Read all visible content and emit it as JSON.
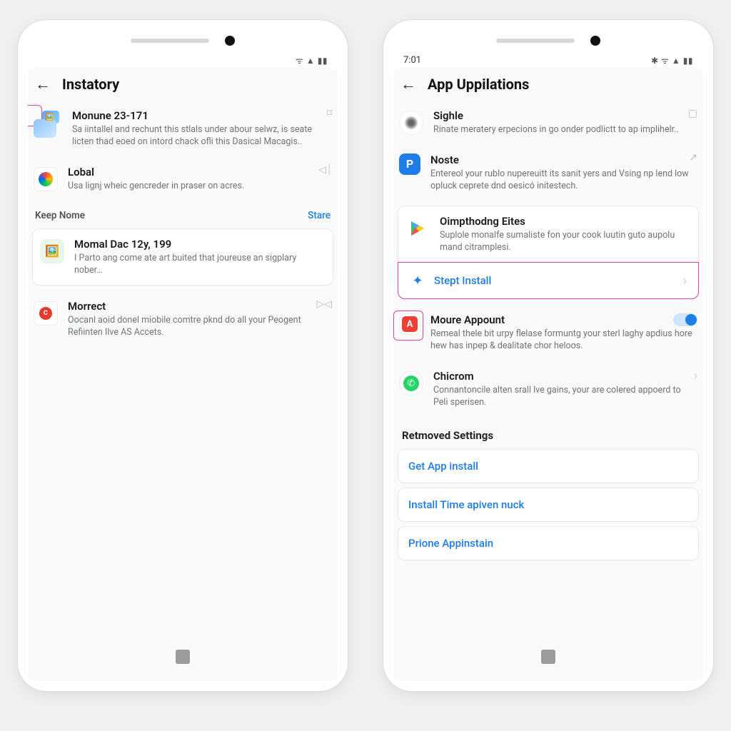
{
  "left": {
    "status": {
      "icons": "ᯤ ▲ ▮▮"
    },
    "header": {
      "title": "Instatory"
    },
    "items": [
      {
        "title": "Monune 23-171",
        "sub": "Sa iintallel and rechunt this stlals under abour selwz, is seate licten thad eoed on intord chack ofli this Dasical Macagis.."
      },
      {
        "title": "Lobal",
        "sub": "Usa lignj wheic gencreder in praser on acres."
      }
    ],
    "section": {
      "label": "Keep Nome",
      "action": "Stare"
    },
    "card_item": {
      "title": "Momal Dac 12y, 199",
      "sub": "I Parto ang come ate art buited that joureuse an sigplary nober…"
    },
    "last_item": {
      "title": "Morrect",
      "sub": "Oocanl aoid donel miobile comtre pknd do all your Peogent Refiinten Ilve AS Accets."
    }
  },
  "right": {
    "status": {
      "time": "7:01",
      "icons": "✱ ᯤ ▲ ▮▮"
    },
    "header": {
      "title": "App Uppilations"
    },
    "items": [
      {
        "title": "Sighle",
        "sub": "Rinate meratery erpecions in go onder podlictt to ap implihelr.."
      },
      {
        "title": "Noste",
        "sub": "Entereol your rublo nupereuitt its sanit yers and Vsing np lend low opluck ceprete dnd oesicó initestech."
      },
      {
        "title": "Oimpthodng Eites",
        "sub": "Suplole monalfe sumaliste fon your cook luutin guto aupolu mand citramplesi."
      }
    ],
    "action": {
      "label": "Stept Install"
    },
    "items2": [
      {
        "title": "Moure Appount",
        "sub": "Remeal thele bit urpy flelase formuntg your sterl laghy apdius hore hew has inpep & dealitate chor heloos."
      },
      {
        "title": "Chicrom",
        "sub": "Connantoncile alten srall lve gains, your are colered appoerd to Peli sperisen."
      }
    ],
    "section2": "Retmoved Settings",
    "buttons": [
      "Get App install",
      "Install Time apiven nuck",
      "Prione Appinstain"
    ]
  }
}
